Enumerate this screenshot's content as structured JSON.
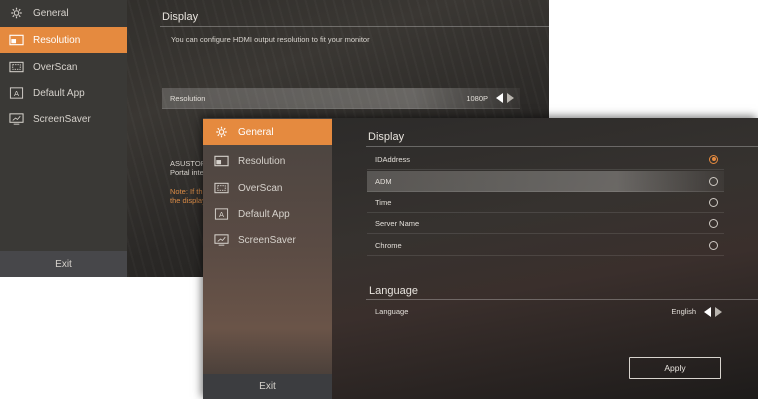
{
  "back_window": {
    "sidebar": {
      "items": [
        {
          "label": "General",
          "icon": "gear-icon"
        },
        {
          "label": "Resolution",
          "icon": "monitor-icon"
        },
        {
          "label": "OverScan",
          "icon": "overscan-icon"
        },
        {
          "label": "Default App",
          "icon": "app-a-icon"
        },
        {
          "label": "ScreenSaver",
          "icon": "screensaver-icon"
        }
      ],
      "active": "Resolution",
      "exit_label": "Exit"
    },
    "main": {
      "title": "Display",
      "description": "You can configure  HDMI output resolution to  fit your monitor",
      "resolution_label": "Resolution",
      "resolution_value": "1080P",
      "partial_text_1": "ASUSTOR",
      "partial_text_2": "Portal inte",
      "partial_note_1": "Note: If th",
      "partial_note_2": "the display"
    }
  },
  "front_window": {
    "sidebar": {
      "items": [
        {
          "label": "General",
          "icon": "gear-icon"
        },
        {
          "label": "Resolution",
          "icon": "monitor-icon"
        },
        {
          "label": "OverScan",
          "icon": "overscan-icon"
        },
        {
          "label": "Default App",
          "icon": "app-a-icon"
        },
        {
          "label": "ScreenSaver",
          "icon": "screensaver-icon"
        }
      ],
      "active": "General",
      "exit_label": "Exit"
    },
    "main": {
      "display_title": "Display",
      "display_options": [
        {
          "label": "IDAddress",
          "selected": true
        },
        {
          "label": "ADM",
          "selected": false
        },
        {
          "label": "Time",
          "selected": false
        },
        {
          "label": "Server Name",
          "selected": false
        },
        {
          "label": "Chrome",
          "selected": false
        }
      ],
      "language_title": "Language",
      "language_label": "Language",
      "language_value": "English",
      "apply_label": "Apply"
    }
  },
  "colors": {
    "accent": "#e58a3f",
    "note_orange": "#d98a45"
  }
}
